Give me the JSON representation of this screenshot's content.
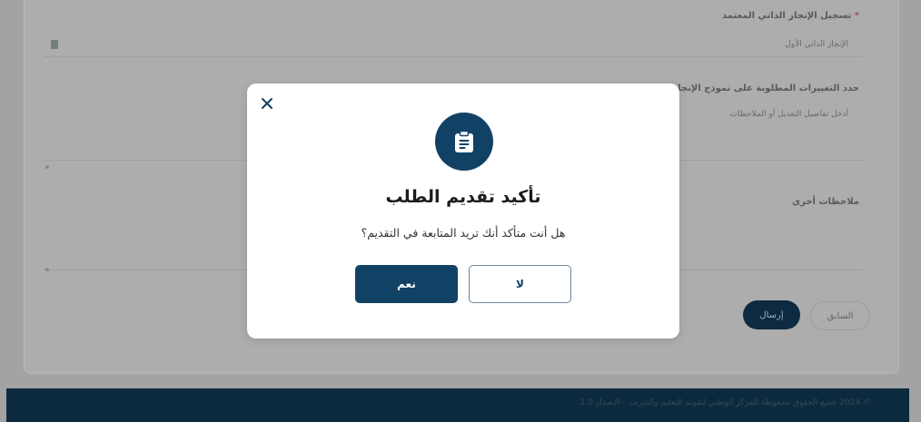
{
  "background_form": {
    "field1_label": "تسجيل الإنجاز الذاتي المعتمد",
    "field1_required_mark": "*",
    "field1_placeholder": "الإنجاز الذاتي الأول",
    "field2_label": "حدد التغييرات المطلوبة على نموذج الإنجاز الذاتي",
    "field2_placeholder": "أدخل تفاصيل التعديل أو الملاحظات",
    "field3_label": "ملاحظات أخرى",
    "send_button": "إرسال",
    "previous_button": "السابق"
  },
  "footer": {
    "text": "© 2024 جميع الحقوق محفوظة للمركز الوطني لتقويم التعليم والتدريب - الإصدار 1.0"
  },
  "modal": {
    "close_icon": "close-icon",
    "header_icon": "clipboard-icon",
    "title": "تأكيد تقديم الطلب",
    "message": "هل أنت متأكد أنك تريد المتابعة في التقديم؟",
    "yes_label": "نعم",
    "no_label": "لا"
  },
  "colors": {
    "primary": "#124166",
    "overlay": "#a3a3a3",
    "footer": "#0c2a3d"
  }
}
